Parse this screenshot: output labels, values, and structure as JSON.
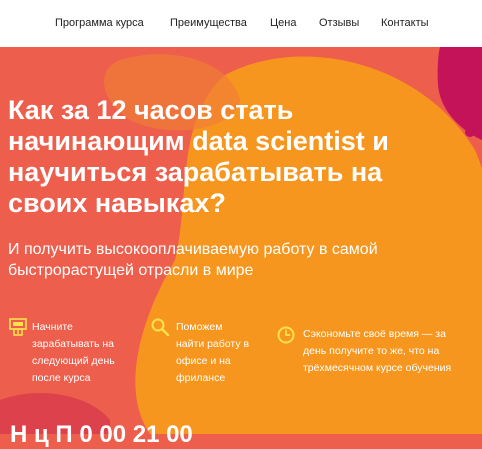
{
  "nav": {
    "items": [
      {
        "label": "Программа курса"
      },
      {
        "label": "Преимущества"
      },
      {
        "label": "Цена"
      },
      {
        "label": "Отзывы"
      },
      {
        "label": "Контакты"
      }
    ]
  },
  "hero": {
    "headline_lines": [
      "Как за 12 часов стать",
      "начинающим data scientist и",
      "научиться зарабатывать на",
      "своих навыках?"
    ],
    "subline_lines": [
      "И получить высокооплачиваемую работу в самой",
      "быстрорастущей отрасли в мире"
    ]
  },
  "features": [
    {
      "icon": "money-icon",
      "lines": [
        "Начните",
        "зарабатывать на",
        "следующий день",
        "после курса"
      ]
    },
    {
      "icon": "search-icon",
      "lines": [
        "Поможем",
        "найти работу в",
        "офисе и на",
        "фрилансе"
      ]
    },
    {
      "icon": "clock-icon",
      "lines": [
        "Сэкономьте своё время — за",
        "день получите то же, что на",
        "трёхмесячном курсе обучения"
      ]
    }
  ],
  "bottom": {
    "partial_text": "Н                  ц       П         0 00   21 00"
  },
  "colors": {
    "background": "#ee5e4c",
    "orange_blob": "#f7961e",
    "magenta_blob": "#c5135a",
    "icon_yellow": "#ffe14d",
    "text": "#ffffff",
    "nav_bg": "#ffffff"
  }
}
